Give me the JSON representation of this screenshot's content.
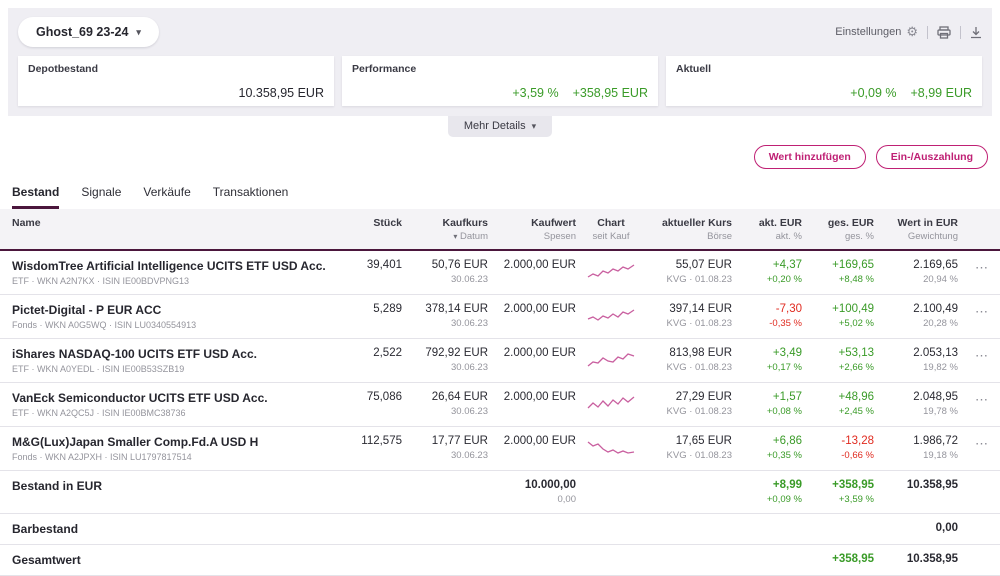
{
  "topbar": {
    "depot_name": "Ghost_69 23-24",
    "settings_label": "Einstellungen",
    "more_details_label": "Mehr Details",
    "cards": [
      {
        "label": "Depotbestand",
        "value": "10.358,95 EUR"
      },
      {
        "label": "Performance",
        "pct": "+3,59 %",
        "value": "+358,95 EUR"
      },
      {
        "label": "Aktuell",
        "pct": "+0,09 %",
        "value": "+8,99 EUR"
      }
    ]
  },
  "actions": {
    "add_label": "Wert hinzufügen",
    "payment_label": "Ein-/Auszahlung"
  },
  "tabs": [
    {
      "label": "Bestand",
      "active": true
    },
    {
      "label": "Signale",
      "active": false
    },
    {
      "label": "Verkäufe",
      "active": false
    },
    {
      "label": "Transaktionen",
      "active": false
    }
  ],
  "icons": {
    "chevron_down": "▾",
    "gear": "⚙",
    "more": "⋯"
  },
  "table": {
    "columns": {
      "name": "Name",
      "stueck": "Stück",
      "kaufkurs": "Kaufkurs",
      "kaufkurs_sub": "Datum",
      "kaufwert": "Kaufwert",
      "kaufwert_sub": "Spesen",
      "chart": "Chart",
      "chart_sub": "seit Kauf",
      "kurs": "aktueller Kurs",
      "kurs_sub": "Börse",
      "akt": "akt. EUR",
      "akt_sub": "akt. %",
      "ges": "ges. EUR",
      "ges_sub": "ges. %",
      "wert": "Wert in EUR",
      "wert_sub": "Gewichtung"
    },
    "rows": [
      {
        "name": "WisdomTree Artificial Intelligence UCITS ETF USD Acc.",
        "sub": "ETF · WKN A2N7KX · ISIN IE00BDVPNG13",
        "stueck": "39,401",
        "kaufkurs": "50,76 EUR",
        "datum": "30.06.23",
        "kaufwert": "2.000,00 EUR",
        "spark": "1,16 6,13 11,15 16,10 21,12 26,8 31,10 36,6 41,8 47,4",
        "kurs": "55,07 EUR",
        "boerse": "KVG · 01.08.23",
        "akt_eur": "+4,37",
        "akt_pct": "+0,20 %",
        "akt_dir": "pos",
        "ges_eur": "+169,65",
        "ges_pct": "+8,48 %",
        "ges_dir": "pos",
        "wert": "2.169,65",
        "gewichtung": "20,94 %"
      },
      {
        "name": "Pictet-Digital - P EUR ACC",
        "sub": "Fonds · WKN A0G5WQ · ISIN LU0340554913",
        "stueck": "5,289",
        "kaufkurs": "378,14 EUR",
        "datum": "30.06.23",
        "kaufwert": "2.000,00 EUR",
        "spark": "1,14 6,12 11,15 16,11 21,13 26,9 31,12 36,7 41,9 47,5",
        "kurs": "397,14 EUR",
        "boerse": "KVG · 01.08.23",
        "akt_eur": "-7,30",
        "akt_pct": "-0,35 %",
        "akt_dir": "neg",
        "ges_eur": "+100,49",
        "ges_pct": "+5,02 %",
        "ges_dir": "pos",
        "wert": "2.100,49",
        "gewichtung": "20,28 %"
      },
      {
        "name": "iShares NASDAQ-100 UCITS ETF USD Acc.",
        "sub": "ETF · WKN A0YEDL · ISIN IE00B53SZB19",
        "stueck": "2,522",
        "kaufkurs": "792,92 EUR",
        "datum": "30.06.23",
        "kaufwert": "2.000,00 EUR",
        "spark": "1,17 6,13 11,14 16,9 21,12 26,13 31,8 36,10 41,5 47,7",
        "kurs": "813,98 EUR",
        "boerse": "KVG · 01.08.23",
        "akt_eur": "+3,49",
        "akt_pct": "+0,17 %",
        "akt_dir": "pos",
        "ges_eur": "+53,13",
        "ges_pct": "+2,66 %",
        "ges_dir": "pos",
        "wert": "2.053,13",
        "gewichtung": "19,82 %"
      },
      {
        "name": "VanEck Semiconductor UCITS ETF USD Acc.",
        "sub": "ETF · WKN A2QC5J · ISIN IE00BMC38736",
        "stueck": "75,086",
        "kaufkurs": "26,64 EUR",
        "datum": "30.06.23",
        "kaufwert": "2.000,00 EUR",
        "spark": "1,15 6,10 11,14 16,8 21,13 26,7 31,11 36,5 41,9 47,4",
        "kurs": "27,29 EUR",
        "boerse": "KVG · 01.08.23",
        "akt_eur": "+1,57",
        "akt_pct": "+0,08 %",
        "akt_dir": "pos",
        "ges_eur": "+48,96",
        "ges_pct": "+2,45 %",
        "ges_dir": "pos",
        "wert": "2.048,95",
        "gewichtung": "19,78 %"
      },
      {
        "name": "M&G(Lux)Japan Smaller Comp.Fd.A USD H",
        "sub": "Fonds · WKN A2JPXH · ISIN LU1797817514",
        "stueck": "112,575",
        "kaufkurs": "17,77 EUR",
        "datum": "30.06.23",
        "kaufwert": "2.000,00 EUR",
        "spark": "1,5 6,9 11,7 16,12 21,15 26,13 31,16 36,14 41,16 47,15",
        "kurs": "17,65 EUR",
        "boerse": "KVG · 01.08.23",
        "akt_eur": "+6,86",
        "akt_pct": "+0,35 %",
        "akt_dir": "pos",
        "ges_eur": "-13,28",
        "ges_pct": "-0,66 %",
        "ges_dir": "neg",
        "wert": "1.986,72",
        "gewichtung": "19,18 %"
      }
    ],
    "summary": {
      "bestand": {
        "label": "Bestand in EUR",
        "kaufwert": "10.000,00",
        "spesen": "0,00",
        "akt_eur": "+8,99",
        "akt_pct": "+0,09 %",
        "ges_eur": "+358,95",
        "ges_pct": "+3,59 %",
        "wert": "10.358,95"
      },
      "barbestand": {
        "label": "Barbestand",
        "wert": "0,00"
      },
      "gesamtwert": {
        "label": "Gesamtwert",
        "ges_eur": "+358,95",
        "wert": "10.358,95"
      }
    }
  },
  "colors": {
    "accent": "#bf2074",
    "accent-dark": "#4b163c",
    "positive": "#3a9b28",
    "negative": "#e02b20",
    "spark": "#c95f9f",
    "topbar-bg": "#efeef3"
  }
}
